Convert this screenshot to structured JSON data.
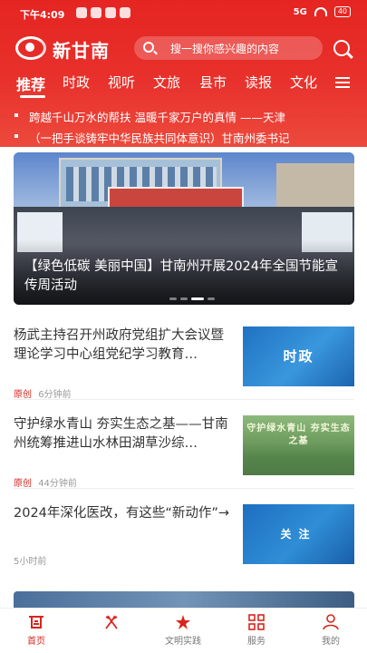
{
  "status_bar": {
    "time": "下午4:09",
    "signal": "5G",
    "battery": "40"
  },
  "header": {
    "app_title": "新甘南",
    "search_placeholder": "搜一搜你感兴趣的内容"
  },
  "tabs": [
    "推荐",
    "时政",
    "视听",
    "文旅",
    "县市",
    "读报",
    "文化"
  ],
  "active_tab": "推荐",
  "tickers": [
    "跨越千山万水的帮扶 温暖千家万户的真情 ——天津",
    "（一把手谈铸牢中华民族共同体意识）甘南州委书记"
  ],
  "banner": {
    "caption": "【绿色低碳 美丽中国】甘南州开展2024年全国节能宣传周活动",
    "slide_count": 4,
    "active_slide": 3
  },
  "news": [
    {
      "title": "杨武主持召开州政府党组扩大会议暨理论学习中心组党纪学习教育…",
      "source": "原创",
      "time": "6分钟前",
      "thumb_label": "时政"
    },
    {
      "title": "守护绿水青山 夯实生态之基——甘南州统筹推进山水林田湖草沙综…",
      "source": "原创",
      "time": "44分钟前",
      "thumb_label": "守护绿水青山 夯实生态之基"
    },
    {
      "title": "2024年深化医改，有这些“新动作”→",
      "source": "",
      "time": "5小时前",
      "thumb_label": "关注"
    }
  ],
  "bottom_nav": {
    "items": [
      {
        "label": "首页",
        "icon": "home-icon",
        "active": true
      },
      {
        "label": "",
        "icon": "deer-logo-icon",
        "active": false
      },
      {
        "label": "文明实践",
        "icon": "civilization-practice-icon",
        "active": false
      },
      {
        "label": "服务",
        "icon": "grid-services-icon",
        "active": false
      },
      {
        "label": "我的",
        "icon": "user-icon",
        "active": false
      }
    ]
  },
  "colors": {
    "brand_red": "#e52522",
    "active_red": "#d7261e",
    "thumb_blue": "#1f72c2"
  }
}
